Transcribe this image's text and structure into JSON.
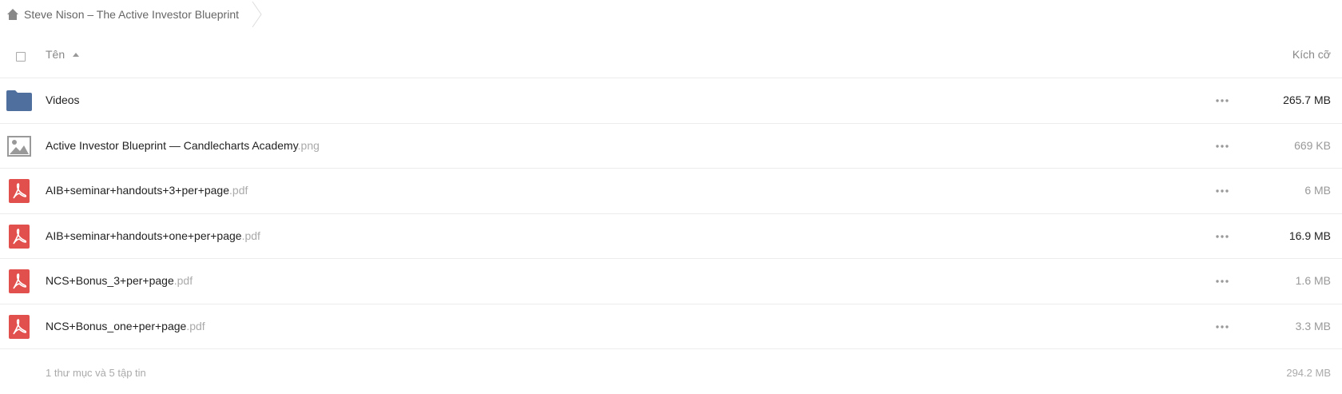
{
  "breadcrumb": {
    "home_icon": "home-icon",
    "current": "Steve Nison – The Active Investor Blueprint"
  },
  "table": {
    "name_header": "Tên",
    "size_header": "Kích cỡ",
    "sort_icon": "sort-ascending-icon"
  },
  "files": [
    {
      "icon": "folder-icon",
      "name": "Videos",
      "ext": "",
      "size": "265.7 MB"
    },
    {
      "icon": "image-icon",
      "name": "Active Investor Blueprint — Candlecharts Academy",
      "ext": ".png",
      "size": "669 KB"
    },
    {
      "icon": "pdf-icon",
      "name": "AIB+seminar+handouts+3+per+page",
      "ext": ".pdf",
      "size": "6 MB"
    },
    {
      "icon": "pdf-icon",
      "name": "AIB+seminar+handouts+one+per+page",
      "ext": ".pdf",
      "size": "16.9 MB"
    },
    {
      "icon": "pdf-icon",
      "name": "NCS+Bonus_3+per+page",
      "ext": ".pdf",
      "size": "1.6 MB"
    },
    {
      "icon": "pdf-icon",
      "name": "NCS+Bonus_one+per+page",
      "ext": ".pdf",
      "size": "3.3 MB"
    }
  ],
  "summary": {
    "text": "1 thư mục và 5 tập tin",
    "total_size": "294.2 MB"
  },
  "colors": {
    "folder": "#4f6f9e",
    "pdf": "#e2504d",
    "image": "#999999"
  }
}
